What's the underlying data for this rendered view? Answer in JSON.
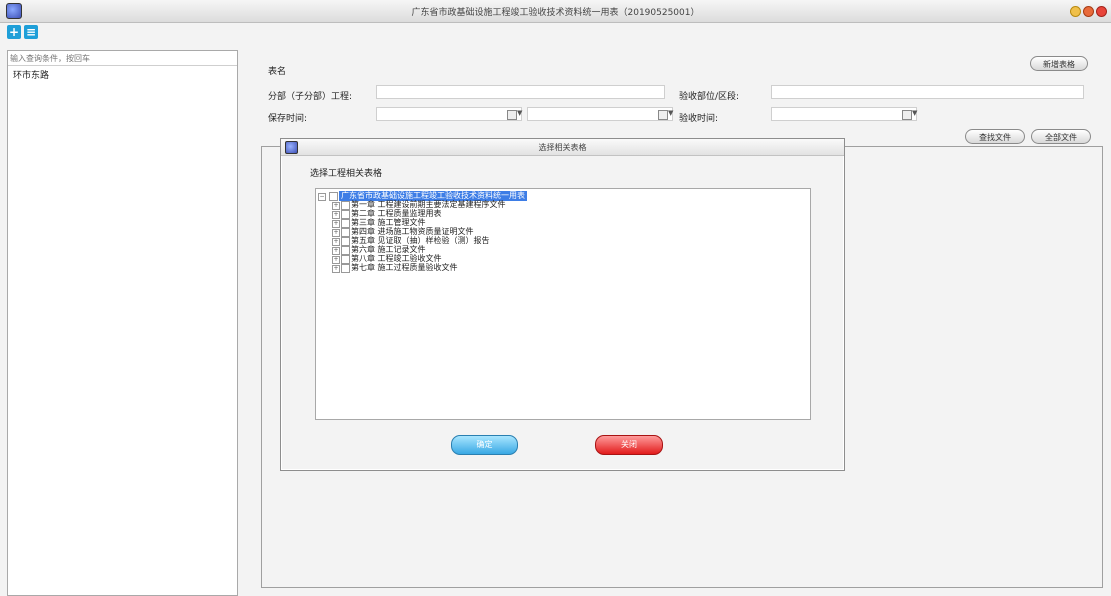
{
  "window": {
    "title": "广东省市政基础设施工程竣工验收技术资料统一用表（20190525001）"
  },
  "toolbar": {
    "add_icon": "add-icon",
    "list_icon": "list-icon"
  },
  "left_panel": {
    "search_placeholder": "输入查询条件，按回车",
    "tree_root": "环市东路"
  },
  "form": {
    "table_name_label": "表名",
    "subproject_label": "分部（子分部）工程:",
    "acceptance_area_label": "验收部位/区段:",
    "save_time_label": "保存时间:",
    "acceptance_time_label": "验收时间:",
    "new_table_button": "新增表格",
    "find_file_button": "查找文件",
    "all_files_button": "全部文件"
  },
  "dialog": {
    "title": "选择相关表格",
    "prompt": "选择工程相关表格",
    "tree": {
      "root": "广东省市政基础设施工程竣工验收技术资料统一用表",
      "children": [
        "第一章 工程建设前期主要法定基建程序文件",
        "第二章 工程质量监理用表",
        "第三章 施工管理文件",
        "第四章 进场施工物资质量证明文件",
        "第五章 见证取（抽）样检验（测）报告",
        "第六章 施工记录文件",
        "第八章 工程竣工验收文件",
        "第七章 施工过程质量验收文件"
      ]
    },
    "ok_button": "确定",
    "cancel_button": "关闭"
  },
  "colors": {
    "selection": "#3d7de6",
    "ok": "#39a8e4",
    "cancel": "#e21b1b"
  }
}
